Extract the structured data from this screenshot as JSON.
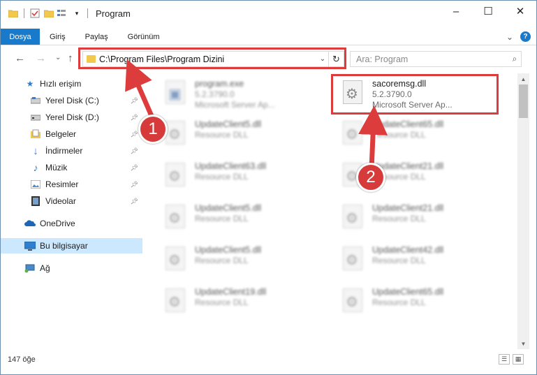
{
  "window": {
    "title": "Program",
    "controls": {
      "minimize": "–",
      "maximize": "☐",
      "close": "✕"
    }
  },
  "ribbon": {
    "tabs": [
      "Dosya",
      "Giriş",
      "Paylaş",
      "Görünüm"
    ],
    "expand": "⌄",
    "help": "?"
  },
  "address": {
    "path": "C:\\Program Files\\Program Dizini",
    "dropdown": "⌄",
    "refresh": "↻"
  },
  "search": {
    "placeholder": "Ara: Program",
    "icon": "⌕"
  },
  "nav": {
    "back": "←",
    "forward": "→",
    "recent": "⌄",
    "up": "↑"
  },
  "sidebar": {
    "quick_access": "Hızlı erişim",
    "items": [
      {
        "label": "Yerel Disk (C:)",
        "icon": "drive-icon",
        "pinned": true
      },
      {
        "label": "Yerel Disk (D:)",
        "icon": "drive-icon",
        "pinned": true
      },
      {
        "label": "Belgeler",
        "icon": "documents-icon",
        "pinned": true
      },
      {
        "label": "İndirmeler",
        "icon": "download-icon",
        "pinned": true
      },
      {
        "label": "Müzik",
        "icon": "music-icon",
        "pinned": true
      },
      {
        "label": "Resimler",
        "icon": "pictures-icon",
        "pinned": true
      },
      {
        "label": "Videolar",
        "icon": "video-icon",
        "pinned": true
      }
    ],
    "onedrive": "OneDrive",
    "this_pc": "Bu bilgisayar",
    "network": "Ağ"
  },
  "files": [
    {
      "name": "program.exe",
      "sub1": "5.2.3790.0",
      "sub2": "Microsoft Server Ap...",
      "blurred": true
    },
    {
      "name": "sacoremsg.dll",
      "sub1": "5.2.3790.0",
      "sub2": "Microsoft Server Ap...",
      "blurred": false
    },
    {
      "name": "UpdateClient5.dll",
      "sub1": "Resource DLL",
      "blurred": true
    },
    {
      "name": "UpdateClient65.dll",
      "sub1": "Resource DLL",
      "blurred": true
    },
    {
      "name": "UpdateClient63.dll",
      "sub1": "Resource DLL",
      "blurred": true
    },
    {
      "name": "UpdateClient21.dll",
      "sub1": "Resource DLL",
      "blurred": true
    },
    {
      "name": "UpdateClient5.dll",
      "sub1": "Resource DLL",
      "blurred": true
    },
    {
      "name": "UpdateClient21.dll",
      "sub1": "Resource DLL",
      "blurred": true
    },
    {
      "name": "UpdateClient5.dll",
      "sub1": "Resource DLL",
      "blurred": true
    },
    {
      "name": "UpdateClient42.dll",
      "sub1": "Resource DLL",
      "blurred": true
    },
    {
      "name": "UpdateClient19.dll",
      "sub1": "Resource DLL",
      "blurred": true
    },
    {
      "name": "UpdateClient65.dll",
      "sub1": "Resource DLL",
      "blurred": true
    }
  ],
  "status": {
    "count": "147 öğe"
  },
  "annotations": {
    "step1": "1",
    "step2": "2",
    "color": "#dc3c3c"
  }
}
